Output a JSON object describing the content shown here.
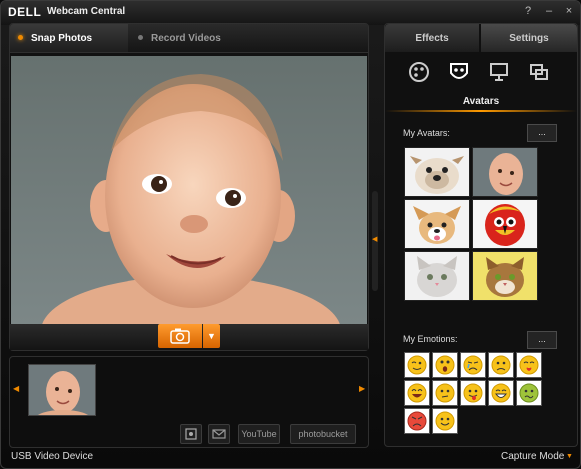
{
  "app": {
    "brand": "DELL",
    "title": "Webcam Central",
    "window_controls": [
      "?",
      "–",
      "×"
    ]
  },
  "left_tabs": [
    {
      "label": "Snap Photos",
      "active": true
    },
    {
      "label": "Record Videos",
      "active": false
    }
  ],
  "controls": {
    "capture_icon": "camera-icon",
    "dropdown_symbol": "▼"
  },
  "thumbnails": {
    "count": 1,
    "prev_arrow": "◀",
    "next_arrow": "▶"
  },
  "share": {
    "youtube_label": "YouTube",
    "photobucket_label": "photobucket"
  },
  "status": {
    "left": "USB Video Device",
    "right": "Capture Mode"
  },
  "right_tabs": [
    {
      "label": "Effects",
      "active": true
    },
    {
      "label": "Settings",
      "active": false
    }
  ],
  "effects": {
    "icons": [
      "palette-icon",
      "mask-icon",
      "presentation-icon",
      "frames-icon"
    ],
    "section_title": "Avatars",
    "my_avatars_label": "My Avatars:",
    "my_emotions_label": "My Emotions:",
    "more_button_label": "...",
    "avatars": [
      "bulldog",
      "baby",
      "puppy",
      "parrot",
      "kitten",
      "cat"
    ],
    "emotions": [
      "wink",
      "surprised",
      "crying",
      "sad",
      "kiss",
      "laughing",
      "thinking",
      "tongue-out",
      "big-grin",
      "confused",
      "angry",
      "happy"
    ]
  },
  "colors": {
    "accent": "#F08A00",
    "background": "#0B0B0B"
  }
}
